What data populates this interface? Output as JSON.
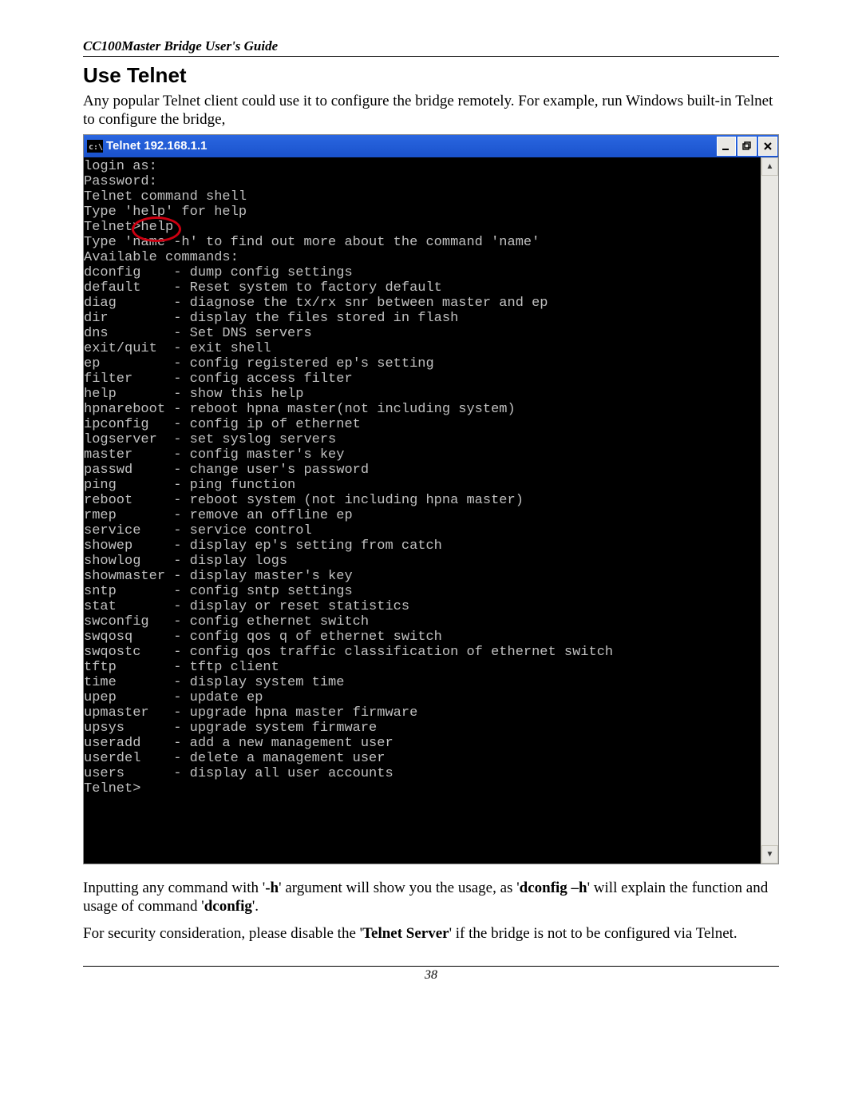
{
  "doc": {
    "header": "CC100Master Bridge User's Guide",
    "section_title": "Use Telnet",
    "intro": "Any popular Telnet client could use it to configure the bridge remotely. For example, run Windows built-in Telnet to configure the bridge,",
    "after_1a": "Inputting any command with '",
    "after_1b": "-h",
    "after_1c": "' argument will show you the usage, as '",
    "after_1d": "dconfig –h",
    "after_1e": "' will explain the function and usage of command '",
    "after_1f": "dconfig",
    "after_1g": "'.",
    "after_2a": "For security consideration, please disable the '",
    "after_2b": "Telnet Server",
    "after_2c": "' if the bridge is not to be configured via Telnet.",
    "page_number": "38"
  },
  "window": {
    "title": "Telnet 192.168.1.1"
  },
  "console_text": "login as:\nPassword:\nTelnet command shell\nType 'help' for help\nTelnet>help\nType 'name -h' to find out more about the command 'name'\nAvailable commands:\ndconfig    - dump config settings\ndefault    - Reset system to factory default\ndiag       - diagnose the tx/rx snr between master and ep\ndir        - display the files stored in flash\ndns        - Set DNS servers\nexit/quit  - exit shell\nep         - config registered ep's setting\nfilter     - config access filter\nhelp       - show this help\nhpnareboot - reboot hpna master(not including system)\nipconfig   - config ip of ethernet\nlogserver  - set syslog servers\nmaster     - config master's key\npasswd     - change user's password\nping       - ping function\nreboot     - reboot system (not including hpna master)\nrmep       - remove an offline ep\nservice    - service control\nshowep     - display ep's setting from catch\nshowlog    - display logs\nshowmaster - display master's key\nsntp       - config sntp settings\nstat       - display or reset statistics\nswconfig   - config ethernet switch\nswqosq     - config qos q of ethernet switch\nswqostc    - config qos traffic classification of ethernet switch\ntftp       - tftp client\ntime       - display system time\nupep       - update ep\nupmaster   - upgrade hpna master firmware\nupsys      - upgrade system firmware\nuseradd    - add a new management user\nuserdel    - delete a management user\nusers      - display all user accounts\nTelnet>"
}
